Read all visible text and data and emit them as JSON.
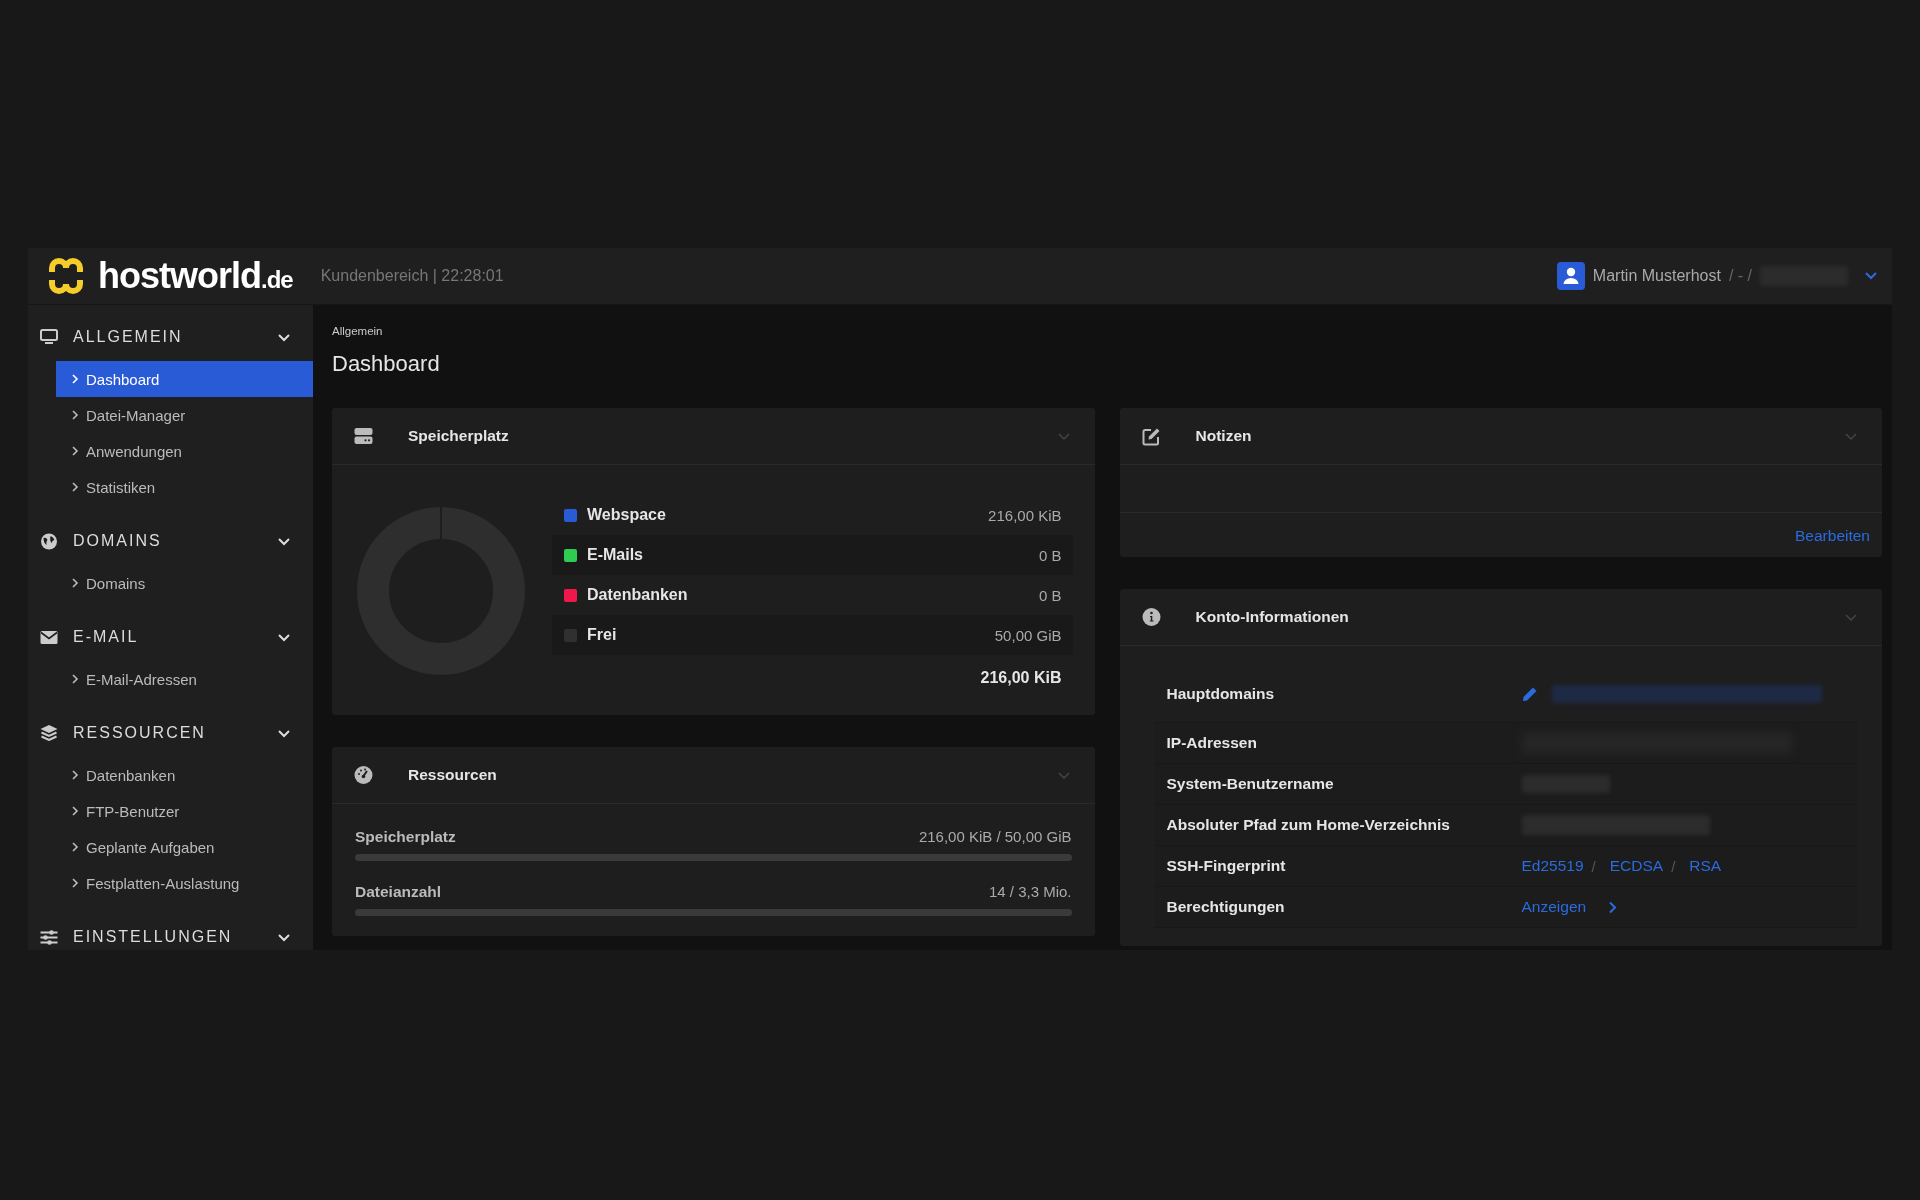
{
  "header": {
    "logo_text": "hostworld",
    "logo_tld": ".de",
    "subtitle": "Kundenbereich | 22:28:01",
    "user": "Martin Musterhost",
    "user_suffix": "/ - /"
  },
  "sidebar": {
    "groups": [
      {
        "title": "ALLGEMEIN",
        "kind": "monitor",
        "expanded": true,
        "items": [
          {
            "label": "Dashboard",
            "selected": true
          },
          {
            "label": "Datei-Manager",
            "selected": false
          },
          {
            "label": "Anwendungen",
            "selected": false
          },
          {
            "label": "Statistiken",
            "selected": false
          }
        ]
      },
      {
        "title": "DOMAINS",
        "kind": "globe",
        "expanded": true,
        "items": [
          {
            "label": "Domains",
            "selected": false
          }
        ]
      },
      {
        "title": "E-MAIL",
        "kind": "mail",
        "expanded": true,
        "items": [
          {
            "label": "E-Mail-Adressen",
            "selected": false
          }
        ]
      },
      {
        "title": "RESSOURCEN",
        "kind": "layers",
        "expanded": true,
        "items": [
          {
            "label": "Datenbanken",
            "selected": false
          },
          {
            "label": "FTP-Benutzer",
            "selected": false
          },
          {
            "label": "Geplante Aufgaben",
            "selected": false
          },
          {
            "label": "Festplatten-Auslastung",
            "selected": false
          }
        ]
      },
      {
        "title": "EINSTELLUNGEN",
        "kind": "sliders",
        "expanded": true
      }
    ]
  },
  "breadcrumb": "Allgemein",
  "page_title": "Dashboard",
  "storage": {
    "title": "Speicherplatz",
    "legend": [
      {
        "label": "Webspace",
        "value": "216,00 KiB",
        "color": "#2a5bd7"
      },
      {
        "label": "E-Mails",
        "value": "0 B",
        "color": "#2ecc50"
      },
      {
        "label": "Datenbanken",
        "value": "0 B",
        "color": "#f0184a"
      },
      {
        "label": "Frei",
        "value": "50,00 GiB",
        "color": "#303030"
      }
    ],
    "total": "216,00 KiB"
  },
  "resources": {
    "title": "Ressourcen",
    "meters": [
      {
        "label": "Speicherplatz",
        "reading": "216,00 KiB / 50,00 GiB",
        "level": 0
      },
      {
        "label": "Dateianzahl",
        "reading": "14 / 3,3 Mio.",
        "level": 0
      }
    ]
  },
  "notes": {
    "title": "Notizen",
    "action": "Bearbeiten"
  },
  "account": {
    "title": "Konto-Informationen",
    "rows": [
      {
        "label": "Hauptdomains",
        "kind": "domain"
      },
      {
        "label": "IP-Adressen",
        "kind": "redacted-wide"
      },
      {
        "label": "System-Benutzername",
        "kind": "redacted-short"
      },
      {
        "label": "Absoluter Pfad zum Home-Verzeichnis",
        "kind": "redacted-medium"
      },
      {
        "label": "SSH-Fingerprint",
        "kind": "links",
        "links": [
          {
            "label": "Ed25519",
            "separator": "/"
          },
          {
            "label": "ECDSA",
            "separator": "/"
          },
          {
            "label": "RSA"
          }
        ]
      },
      {
        "label": "Berechtigungen",
        "kind": "link-arrow",
        "links": [
          {
            "label": "Anzeigen"
          }
        ]
      }
    ]
  }
}
